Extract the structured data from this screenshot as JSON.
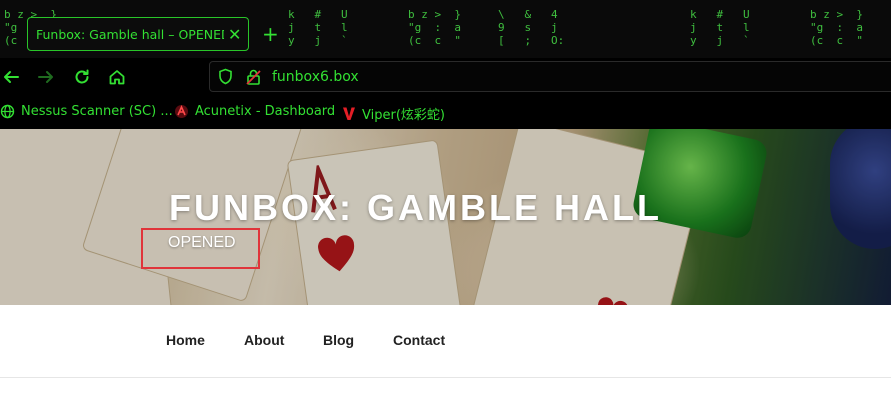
{
  "browser": {
    "tab_title": "Funbox: Gamble hall – OPENED",
    "tab_close": "✕",
    "new_tab": "+",
    "url": "funbox6.box",
    "matrix_glyphs": [
      "b z >  }",
      "\"g  :  a",
      "(c  c  \"",
      "k   #   U",
      "j   t   l",
      "y   j   `",
      "\\   &   4",
      "9   s   j",
      "[   ;   O:"
    ],
    "bookmarks": [
      {
        "label": "Nessus Scanner (SC) ...",
        "icon": "globe-icon"
      },
      {
        "label": "Acunetix - Dashboard",
        "icon": "acunetix-icon"
      },
      {
        "label": "Viper(炫彩蛇)",
        "icon": "viper-v-icon"
      }
    ]
  },
  "site": {
    "title": "FUNBOX: GAMBLE HALL",
    "tagline": "OPENED",
    "menu": [
      "Home",
      "About",
      "Blog",
      "Contact"
    ]
  },
  "colors": {
    "accent_green": "#33e033",
    "highlight_red": "#e0343a"
  }
}
